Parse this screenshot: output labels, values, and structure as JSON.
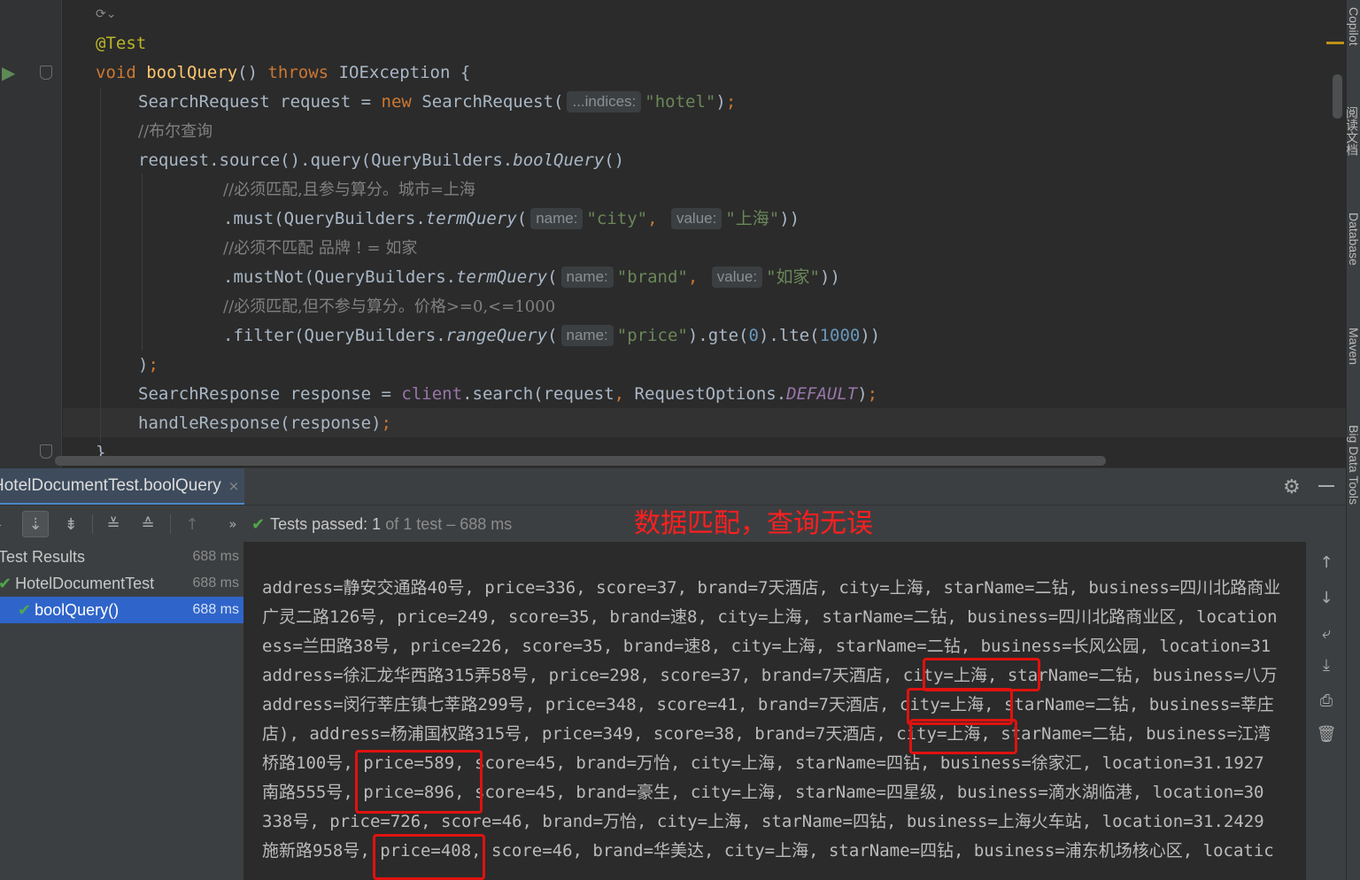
{
  "editor": {
    "lines": [
      {
        "indent": 0,
        "tokens": [
          {
            "t": "@Test",
            "c": "ann"
          }
        ]
      },
      {
        "indent": 0,
        "tokens": [
          {
            "t": "void ",
            "c": "kw"
          },
          {
            "t": "boolQuery",
            "c": "fn"
          },
          {
            "t": "() ",
            "c": ""
          },
          {
            "t": "throws ",
            "c": "kw"
          },
          {
            "t": "IOException {",
            "c": ""
          }
        ]
      },
      {
        "indent": 1,
        "tokens": [
          {
            "t": "SearchRequest request = ",
            "c": ""
          },
          {
            "t": "new ",
            "c": "kw"
          },
          {
            "t": "SearchRequest(",
            "c": ""
          },
          {
            "t": "...indices:",
            "c": "hint"
          },
          {
            "t": "\"hotel\"",
            "c": "str"
          },
          {
            "t": ")",
            "c": ""
          },
          {
            "t": ";",
            "c": "kw"
          }
        ]
      },
      {
        "indent": 1,
        "tokens": [
          {
            "t": "//布尔查询",
            "c": "cmt"
          }
        ]
      },
      {
        "indent": 1,
        "tokens": [
          {
            "t": "request.source().query(QueryBuilders.",
            "c": ""
          },
          {
            "t": "boolQuery",
            "c": "static"
          },
          {
            "t": "()",
            "c": ""
          }
        ]
      },
      {
        "indent": 3,
        "tokens": [
          {
            "t": "//必须匹配,且参与算分。城市=上海",
            "c": "cmt"
          }
        ]
      },
      {
        "indent": 3,
        "tokens": [
          {
            "t": ".must(QueryBuilders.",
            "c": ""
          },
          {
            "t": "termQuery",
            "c": "static"
          },
          {
            "t": "(",
            "c": ""
          },
          {
            "t": "name:",
            "c": "hint"
          },
          {
            "t": "\"city\"",
            "c": "str"
          },
          {
            "t": ", ",
            "c": "kw"
          },
          {
            "t": "value:",
            "c": "hint"
          },
          {
            "t": "\"上海\"",
            "c": "str"
          },
          {
            "t": "))",
            "c": ""
          }
        ]
      },
      {
        "indent": 3,
        "tokens": [
          {
            "t": "//必须不匹配 品牌 ! = 如家",
            "c": "cmt"
          }
        ]
      },
      {
        "indent": 3,
        "tokens": [
          {
            "t": ".mustNot(QueryBuilders.",
            "c": ""
          },
          {
            "t": "termQuery",
            "c": "static"
          },
          {
            "t": "(",
            "c": ""
          },
          {
            "t": "name:",
            "c": "hint"
          },
          {
            "t": "\"brand\"",
            "c": "str"
          },
          {
            "t": ", ",
            "c": "kw"
          },
          {
            "t": "value:",
            "c": "hint"
          },
          {
            "t": "\"如家\"",
            "c": "str"
          },
          {
            "t": "))",
            "c": ""
          }
        ]
      },
      {
        "indent": 3,
        "tokens": [
          {
            "t": "//必须匹配,但不参与算分。价格>=0,<=1000",
            "c": "cmt"
          }
        ]
      },
      {
        "indent": 3,
        "tokens": [
          {
            "t": ".filter(QueryBuilders.",
            "c": ""
          },
          {
            "t": "rangeQuery",
            "c": "static"
          },
          {
            "t": "(",
            "c": ""
          },
          {
            "t": "name:",
            "c": "hint"
          },
          {
            "t": "\"price\"",
            "c": "str"
          },
          {
            "t": ").gte(",
            "c": ""
          },
          {
            "t": "0",
            "c": "num"
          },
          {
            "t": ").lte(",
            "c": ""
          },
          {
            "t": "1000",
            "c": "num"
          },
          {
            "t": "))",
            "c": ""
          }
        ]
      },
      {
        "indent": 1,
        "tokens": [
          {
            "t": ")",
            "c": ""
          },
          {
            "t": ";",
            "c": "kw"
          }
        ]
      },
      {
        "indent": 1,
        "tokens": [
          {
            "t": "SearchResponse response = ",
            "c": ""
          },
          {
            "t": "client",
            "c": "member"
          },
          {
            "t": ".search(request",
            "c": ""
          },
          {
            "t": ", ",
            "c": "kw"
          },
          {
            "t": "RequestOptions.",
            "c": ""
          },
          {
            "t": "DEFAULT",
            "c": "constf"
          },
          {
            "t": ")",
            "c": ""
          },
          {
            "t": ";",
            "c": "kw"
          }
        ]
      },
      {
        "indent": 1,
        "tokens": [
          {
            "t": "handleResponse(response)",
            "c": ""
          },
          {
            "t": ";",
            "c": "kw"
          }
        ]
      },
      {
        "indent": 0,
        "tokens": [
          {
            "t": "}",
            "c": ""
          }
        ]
      }
    ]
  },
  "right_strip": [
    "Copilot",
    "阅读文档",
    "Database",
    "Maven",
    "Big Data Tools"
  ],
  "run_panel": {
    "tab_label": "HotelDocumentTest.boolQuery",
    "tab_close": "×",
    "status_prefix": "Tests passed:",
    "status_count": "1",
    "status_suffix": "of 1 test – 688 ms",
    "annotation": "数据匹配，查询无误"
  },
  "test_tree": [
    {
      "label": "Test Results",
      "time": "688 ms",
      "indent": 0,
      "ok": false,
      "selected": false
    },
    {
      "label": "HotelDocumentTest",
      "time": "688 ms",
      "indent": 0,
      "ok": true,
      "selected": false
    },
    {
      "label": "boolQuery()",
      "time": "688 ms",
      "indent": 1,
      "ok": true,
      "selected": true
    }
  ],
  "console": {
    "lines": [
      "address=静安交通路40号, price=336, score=37, brand=7天酒店, city=上海, starName=二钻, business=四川北路商业",
      "广灵二路126号, price=249, score=35, brand=速8, city=上海, starName=二钻, business=四川北路商业区, location",
      "ess=兰田路38号, price=226, score=35, brand=速8, city=上海, starName=二钻, business=长风公园, location=31",
      "address=徐汇龙华西路315弄58号, price=298, score=37, brand=7天酒店, city=上海, starName=二钻, business=八万",
      "address=闵行莘庄镇七莘路299号, price=348, score=41, brand=7天酒店, city=上海, starName=二钻, business=莘庄",
      "店), address=杨浦国权路315号, price=349, score=38, brand=7天酒店, city=上海, starName=二钻, business=江湾",
      "桥路100号, price=589, score=45, brand=万怡, city=上海, starName=四钻, business=徐家汇, location=31.1927",
      "南路555号, price=896, score=45, brand=豪生, city=上海, starName=四星级, business=滴水湖临港, location=30",
      "338号, price=726, score=46, brand=万怡, city=上海, starName=四钻, business=上海火车站, location=31.2429",
      "施新路958号, price=408, score=46, brand=华美达, city=上海, starName=四钻, business=浦东机场核心区, locatic"
    ]
  },
  "colors": {
    "accent": "#2f65ca",
    "highlight": "#e0120f",
    "pass": "#4fa94b"
  }
}
